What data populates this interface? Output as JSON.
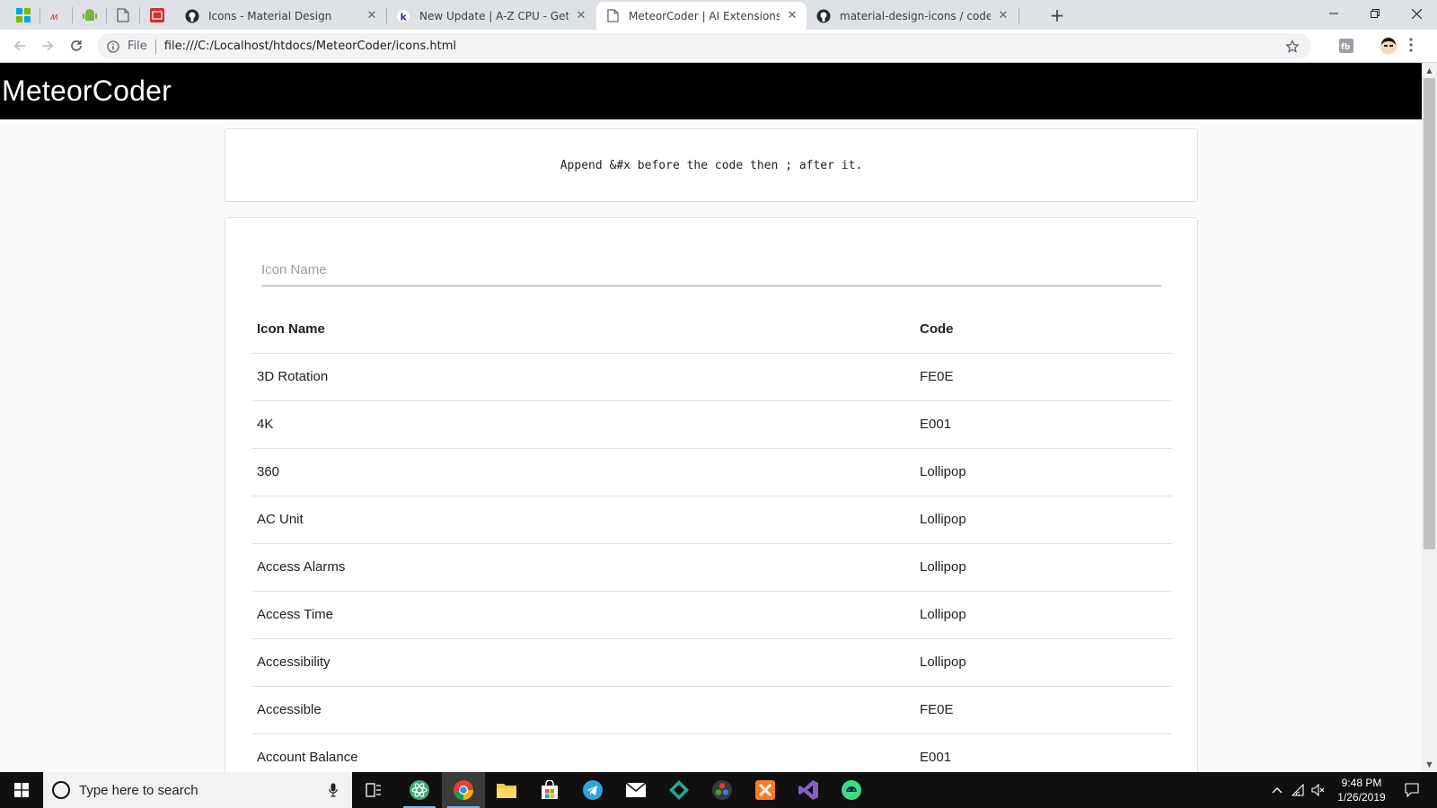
{
  "browser": {
    "tabs": [
      {
        "label": "Icons - Material Design",
        "favicon": "github-octocat-icon",
        "active": false
      },
      {
        "label": "New Update | A-Z CPU - Get All I",
        "favicon": "k-site-icon",
        "active": false
      },
      {
        "label": "MeteorCoder | AI Extensions",
        "favicon": "page-icon",
        "active": true
      },
      {
        "label": "material-design-icons / codepoin",
        "favicon": "github-octocat-icon",
        "active": false
      }
    ],
    "new_tab_glyph": "+",
    "window_controls": {
      "minimize": "—",
      "restore": "❐",
      "close": "✕"
    },
    "address": {
      "scheme_label": "File",
      "url": "file:///C:/Localhost/htdocs/MeteorCoder/icons.html"
    }
  },
  "page": {
    "brand": "MeteorCoder",
    "hint": "Append &#x before the code then ; after it.",
    "search": {
      "placeholder": "Icon Name",
      "value": ""
    },
    "table": {
      "headers": [
        "Icon Name",
        "Code"
      ],
      "rows": [
        [
          "3D Rotation",
          "FE0E"
        ],
        [
          "4K",
          "E001"
        ],
        [
          "360",
          "Lollipop"
        ],
        [
          "AC Unit",
          "Lollipop"
        ],
        [
          "Access Alarms",
          "Lollipop"
        ],
        [
          "Access Time",
          "Lollipop"
        ],
        [
          "Accessibility",
          "Lollipop"
        ],
        [
          "Accessible",
          "FE0E"
        ],
        [
          "Account Balance",
          "E001"
        ]
      ]
    }
  },
  "taskbar": {
    "search_placeholder": "Type here to search",
    "time": "9:48 PM",
    "date": "1/26/2019"
  },
  "colors": {
    "appbar": "#000000",
    "page_bg": "#fafafa",
    "card_bg": "#ffffff",
    "tabbar": "#dee1e6",
    "taskbar": "#101010"
  }
}
